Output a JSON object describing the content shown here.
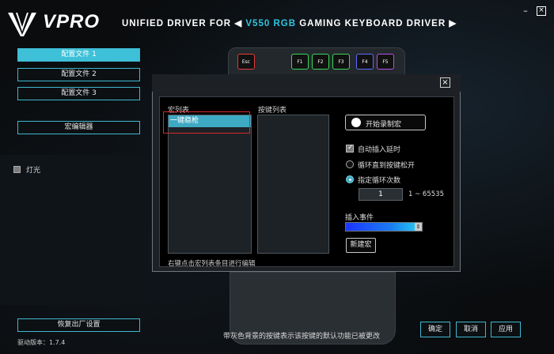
{
  "app": {
    "logo": "VPRO",
    "title_prefix": "UNIFIED DRIVER FOR",
    "title_model": "V550 RGB",
    "title_suffix": "GAMING KEYBOARD DRIVER",
    "nav_left": "◀",
    "nav_right": "▶",
    "minimize": "–",
    "close": "×"
  },
  "sidebar": {
    "profiles": [
      {
        "label": "配置文件 1",
        "active": true
      },
      {
        "label": "配置文件 2",
        "active": false
      },
      {
        "label": "配置文件 3",
        "active": false
      }
    ],
    "macro_editor": "宏编辑器",
    "light_label": "灯光",
    "restore_defaults": "恢复出厂设置",
    "driver_version": "驱动版本：1.7.4"
  },
  "keyboard": {
    "fkeys": [
      "Esc",
      "F1",
      "F2",
      "F3",
      "F4",
      "F5"
    ],
    "fkey_colors": [
      "#e33b3b",
      "#3bd65a",
      "#3bd65a",
      "#3bd65a",
      "#5b6bff",
      "#b450e8"
    ]
  },
  "footer": {
    "note": "带灰色背景的按键表示该按键的默认功能已被更改",
    "ok": "确定",
    "cancel": "取消",
    "apply": "应用"
  },
  "dialog": {
    "close": "×",
    "macro_list_title": "宏列表",
    "macro_items": [
      "一键稳枪"
    ],
    "key_list_title": "按键列表",
    "edit_hint": "右键点击宏列表条目进行编辑",
    "record_button": "开始录制宏",
    "auto_delay": "自动插入延时",
    "auto_delay_checked": true,
    "loop_until_release": "循环直到按键松开",
    "loop_count": "指定循环次数",
    "loop_count_selected": true,
    "loop_count_value": "1",
    "loop_range": "1 ~ 65535",
    "insert_event": "插入事件",
    "new_macro": "新建宏"
  }
}
